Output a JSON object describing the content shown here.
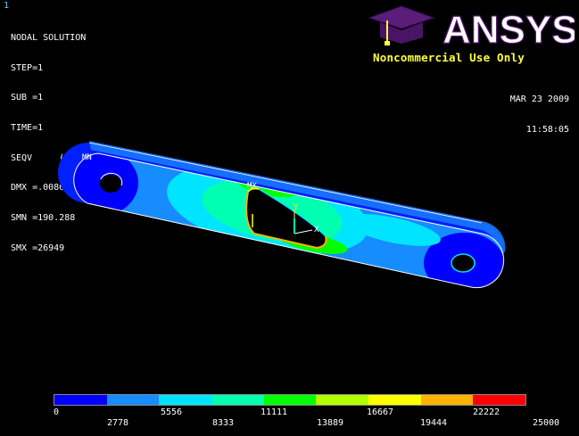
{
  "window_number": "1",
  "info": {
    "title": "NODAL SOLUTION",
    "lines": [
      "STEP=1",
      "SUB =1",
      "TIME=1",
      "SEQV     (AVG)",
      "DMX =.008638",
      "SMN =190.288",
      "SMX =26949"
    ]
  },
  "header": {
    "date": "MAR 23 2009",
    "time": "11:58:05",
    "logo_text": "ANSYS",
    "noncommercial": "Noncommercial Use Only"
  },
  "markers": {
    "min": "MN",
    "max": "MX",
    "y_axis": "Y",
    "x_axis": "X"
  },
  "legend": {
    "colors": [
      "#0000ff",
      "#178cff",
      "#00e5ff",
      "#00ffb0",
      "#00ff00",
      "#b2ff00",
      "#ffff00",
      "#ffb200",
      "#ff0000"
    ],
    "labels_top": [
      "0",
      "5556",
      "11111",
      "16667",
      "22222"
    ],
    "labels_bottom": [
      "2778",
      "8333",
      "13889",
      "19444",
      "25000"
    ]
  },
  "colors": {
    "background": "#000000",
    "logo_yellow": "#ffff3c",
    "logo_purple": "#5a1d7a",
    "window_number": "#5fd0ff"
  }
}
